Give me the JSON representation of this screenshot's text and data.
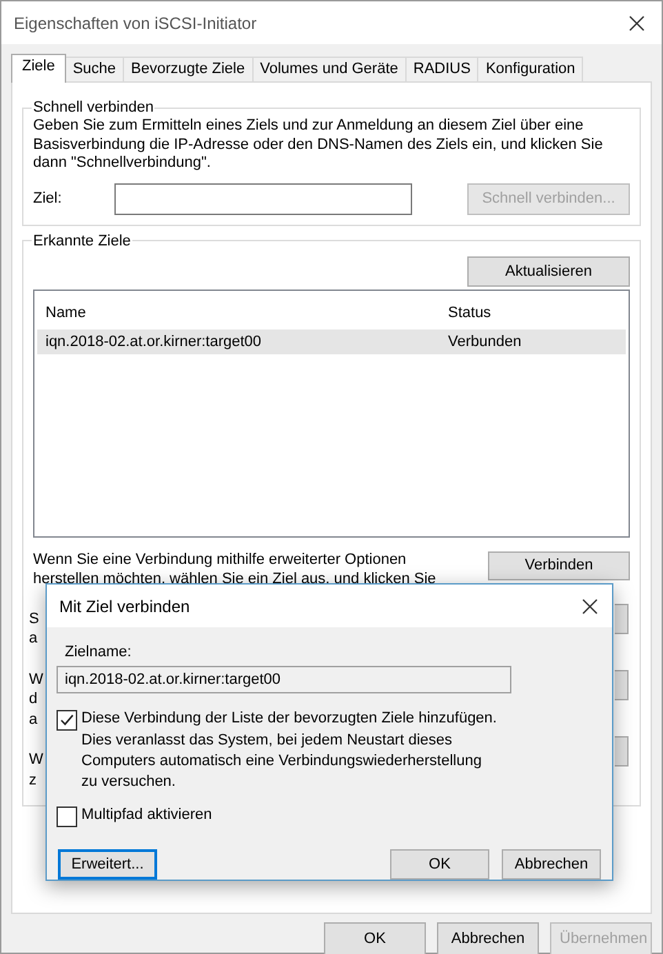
{
  "window": {
    "title": "Eigenschaften von iSCSI-Initiator"
  },
  "tabs": [
    {
      "label": "Ziele",
      "selected": true
    },
    {
      "label": "Suche",
      "selected": false
    },
    {
      "label": "Bevorzugte Ziele",
      "selected": false
    },
    {
      "label": "Volumes und Geräte",
      "selected": false
    },
    {
      "label": "RADIUS",
      "selected": false
    },
    {
      "label": "Konfiguration",
      "selected": false
    }
  ],
  "quick_connect": {
    "title": "Schnell verbinden",
    "description": "Geben Sie zum Ermitteln eines Ziels und zur Anmeldung an diesem Ziel über eine Basisverbindung die IP-Adresse oder den DNS-Namen des Ziels ein, und klicken Sie dann \"Schnellverbindung\".",
    "target_label": "Ziel:",
    "button": {
      "label": "Schnell verbinden...",
      "disabled": true
    }
  },
  "discovered_targets": {
    "title": "Erkannte Ziele",
    "refresh_button": "Aktualisieren",
    "columns": [
      "Name",
      "Status"
    ],
    "rows": [
      {
        "name": "iqn.2018-02.at.or.kirner:target00",
        "status": "Verbunden",
        "selected": true
      }
    ],
    "connect_text": [
      "Wenn Sie eine Verbindung mithilfe erweiterter Optionen",
      "herstellen möchten, wählen Sie ein Ziel aus, und klicken Sie"
    ],
    "connect_button": "Verbinden",
    "covered_fragments": [
      "S",
      "a",
      "W",
      "d",
      "a",
      "W",
      "z"
    ]
  },
  "footer_buttons": [
    {
      "label": "OK",
      "disabled": false
    },
    {
      "label": "Abbrechen",
      "disabled": false
    },
    {
      "label": "Übernehmen",
      "disabled": true
    }
  ],
  "dialog": {
    "title": "Mit Ziel verbinden",
    "target_name_label": "Zielname:",
    "target_name": "iqn.2018-02.at.or.kirner:target00",
    "options": [
      {
        "label": "Diese Verbindung der Liste der bevorzugten Ziele hinzufügen.",
        "description": "Dies veranlasst das System, bei jedem Neustart dieses Computers automatisch eine Verbindungswiederherstellung zu versuchen.",
        "checked": true
      },
      {
        "label": "Multipfad aktivieren",
        "checked": false
      }
    ],
    "buttons": [
      {
        "label": "Erweitert...",
        "focused": true
      },
      {
        "label": "OK",
        "focused": false
      },
      {
        "label": "Abbrechen",
        "focused": false
      }
    ]
  }
}
